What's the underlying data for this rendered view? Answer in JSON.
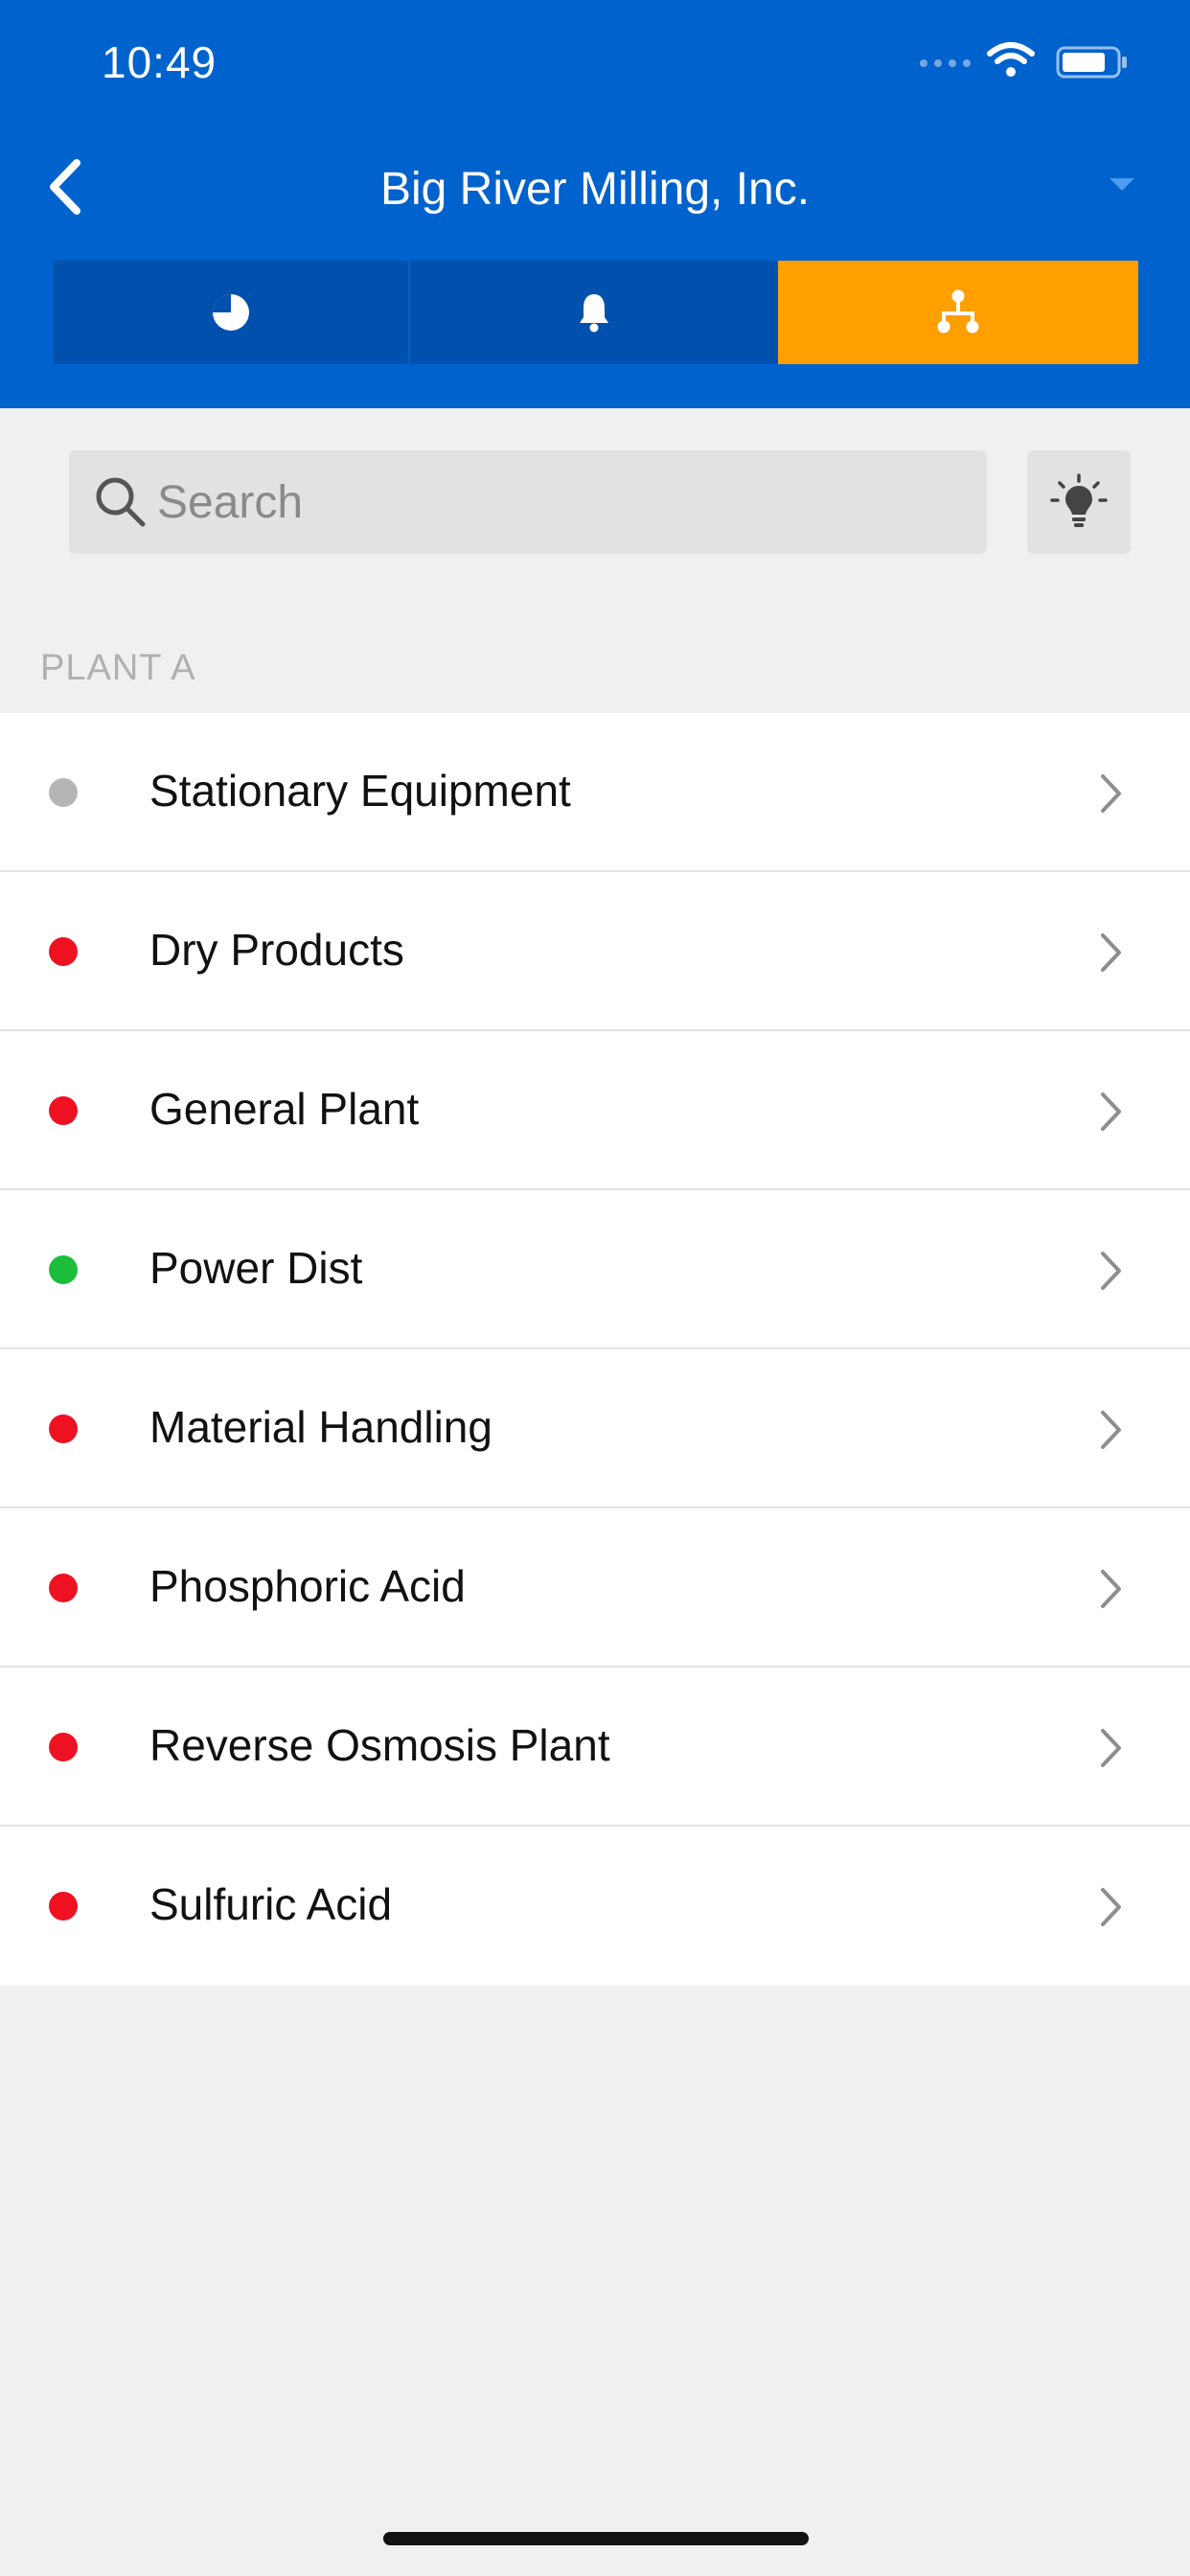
{
  "status_bar": {
    "time": "10:49"
  },
  "nav": {
    "title": "Big River Milling, Inc."
  },
  "tabs": [
    {
      "icon": "pie-chart-icon",
      "active": false
    },
    {
      "icon": "bell-icon",
      "active": false
    },
    {
      "icon": "hierarchy-icon",
      "active": true
    }
  ],
  "search": {
    "placeholder": "Search",
    "value": ""
  },
  "section": {
    "title": "PLANT A"
  },
  "items": [
    {
      "label": "Stationary Equipment",
      "status_color": "#b5b5b5"
    },
    {
      "label": "Dry Products",
      "status_color": "#ee1122"
    },
    {
      "label": "General Plant",
      "status_color": "#ee1122"
    },
    {
      "label": "Power Dist",
      "status_color": "#1dbd3c"
    },
    {
      "label": "Material Handling",
      "status_color": "#ee1122"
    },
    {
      "label": "Phosphoric Acid",
      "status_color": "#ee1122"
    },
    {
      "label": "Reverse Osmosis Plant",
      "status_color": "#ee1122"
    },
    {
      "label": "Sulfuric Acid",
      "status_color": "#ee1122"
    }
  ],
  "colors": {
    "header": "#0062cc",
    "tab_inactive": "#0050ad",
    "tab_active": "#ff9f00"
  }
}
